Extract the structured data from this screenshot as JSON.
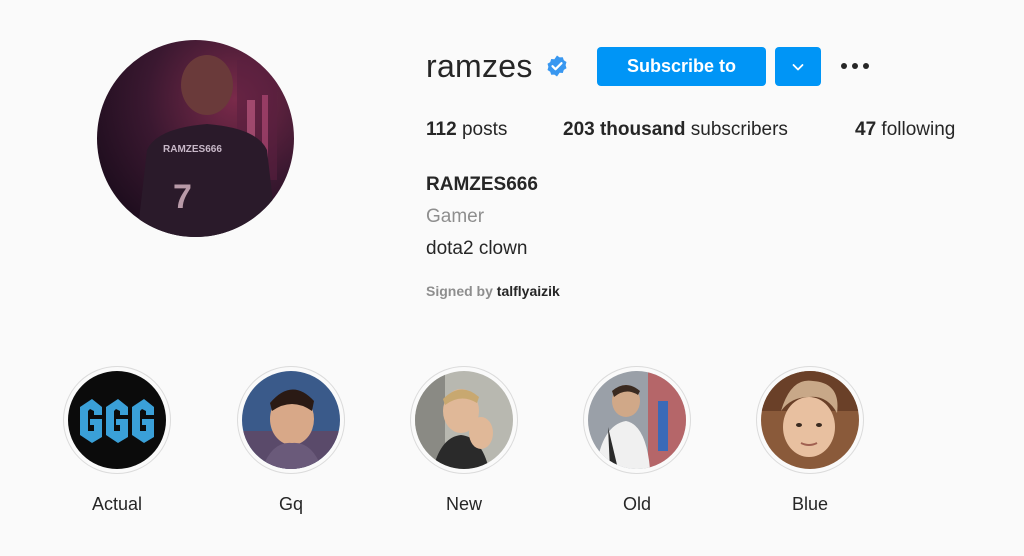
{
  "profile": {
    "username": "ramzes",
    "subscribe_label": "Subscribe to",
    "stats": {
      "posts_count": "112",
      "posts_label": "posts",
      "subscribers_count": "203 thousand",
      "subscribers_label": "subscribers",
      "following_count": "47",
      "following_label": "following"
    },
    "full_name": "RAMZES666",
    "category": "Gamer",
    "bio": "dota2 clown",
    "signed_by_label": "Signed by",
    "signed_by_user": "talflyaizik",
    "avatar_jersey_text": "RAMZES666",
    "avatar_jersey_number": "7"
  },
  "highlights": [
    {
      "label": "Actual"
    },
    {
      "label": "Gq"
    },
    {
      "label": "New"
    },
    {
      "label": "Old"
    },
    {
      "label": "Blue"
    }
  ],
  "colors": {
    "accent": "#0095f6",
    "verified": "#3897f0",
    "muted_text": "#8e8e8e",
    "text": "#262626",
    "background": "#fafafa"
  },
  "icons": {
    "verified": "verified-badge-icon",
    "dropdown": "chevron-down-icon",
    "more": "more-options-icon"
  }
}
